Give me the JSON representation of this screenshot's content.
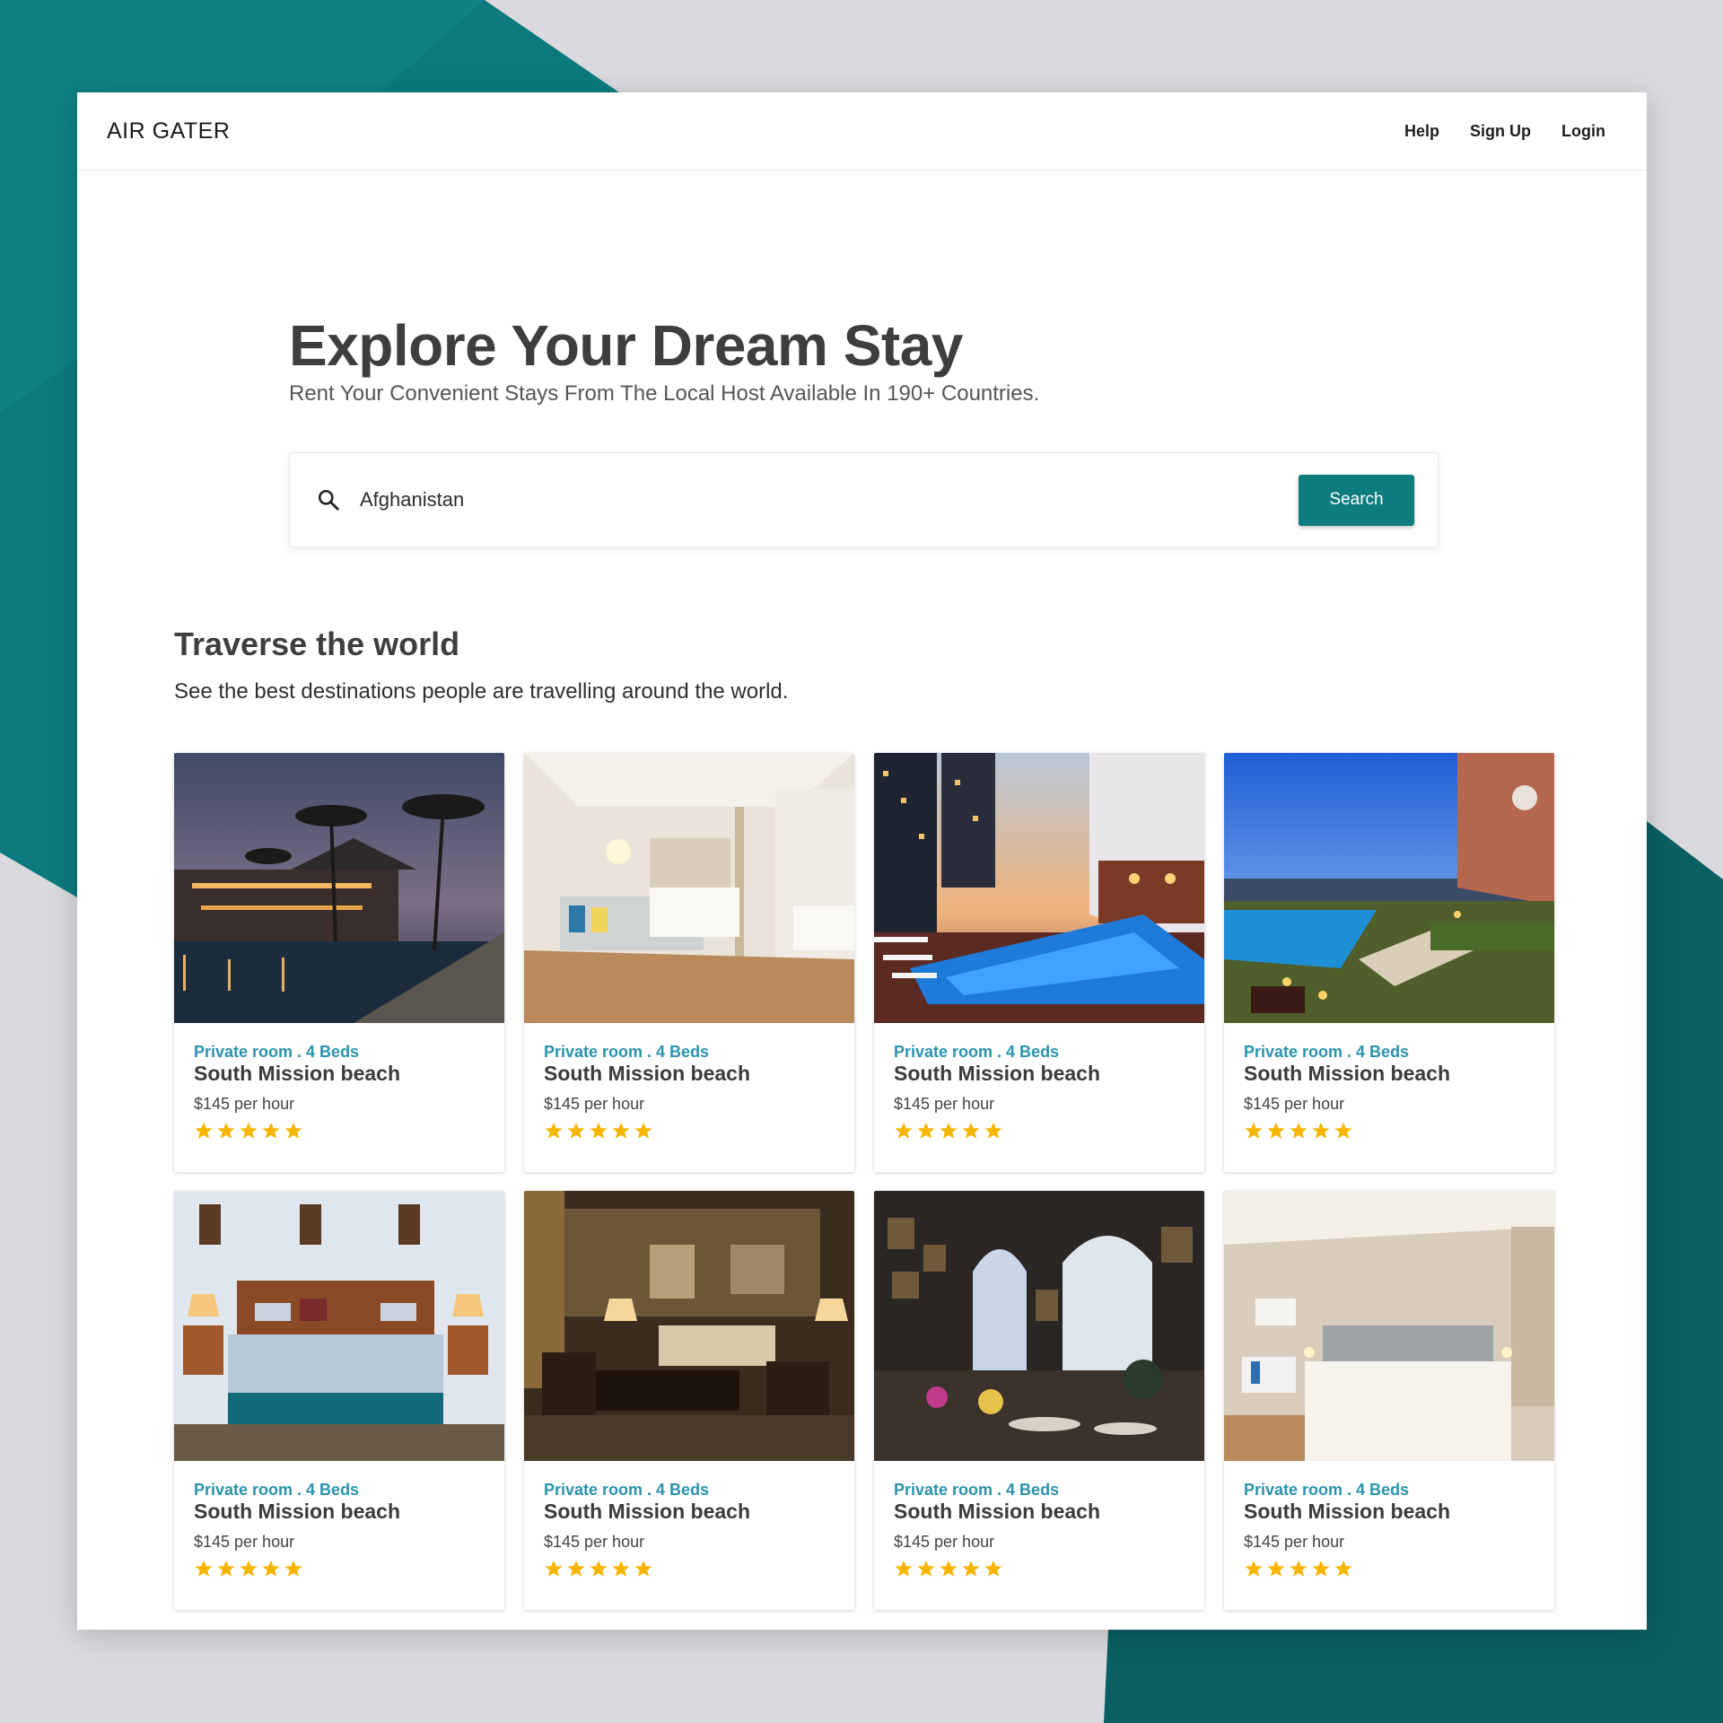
{
  "brand": {
    "name": "AIR GATER",
    "accent": "#0e7c7f",
    "tag_color": "#2a93ac",
    "star_color": "#f7b500"
  },
  "nav": {
    "links": [
      "Help",
      "Sign Up",
      "Login"
    ]
  },
  "hero": {
    "title": "Explore Your Dream Stay",
    "subtitle": "Rent Your Convenient Stays From The Local Host Available In 190+ Countries."
  },
  "search": {
    "value": "Afghanistan",
    "button_label": "Search",
    "icon": "search-icon"
  },
  "section": {
    "title": "Traverse the world",
    "subtitle": "See the best destinations people are travelling around the world."
  },
  "listings": [
    {
      "tag": "Private room . 4 Beds",
      "title": "South Mission beach",
      "price": "$145 per hour",
      "rating": 5,
      "photo": "resort pool at dusk with palm trees"
    },
    {
      "tag": "Private room . 4 Beds",
      "title": "South Mission beach",
      "price": "$145 per hour",
      "rating": 5,
      "photo": "bright hotel room with twin beds"
    },
    {
      "tag": "Private room . 4 Beds",
      "title": "South Mission beach",
      "price": "$145 per hour",
      "rating": 5,
      "photo": "rooftop pool between skyscrapers"
    },
    {
      "tag": "Private room . 4 Beds",
      "title": "South Mission beach",
      "price": "$145 per hour",
      "rating": 5,
      "photo": "rooftop terrace pool at sunset"
    },
    {
      "tag": "Private room . 4 Beds",
      "title": "South Mission beach",
      "price": "$145 per hour",
      "rating": 5,
      "photo": "bedroom with wooden bed and lamps"
    },
    {
      "tag": "Private room . 4 Beds",
      "title": "South Mission beach",
      "price": "$145 per hour",
      "rating": 5,
      "photo": "dim lounge with sofas and lamps"
    },
    {
      "tag": "Private room . 4 Beds",
      "title": "South Mission beach",
      "price": "$145 per hour",
      "rating": 5,
      "photo": "ornate cafe with arched windows"
    },
    {
      "tag": "Private room . 4 Beds",
      "title": "South Mission beach",
      "price": "$145 per hour",
      "rating": 5,
      "photo": "minimal hotel room with white bed"
    }
  ]
}
